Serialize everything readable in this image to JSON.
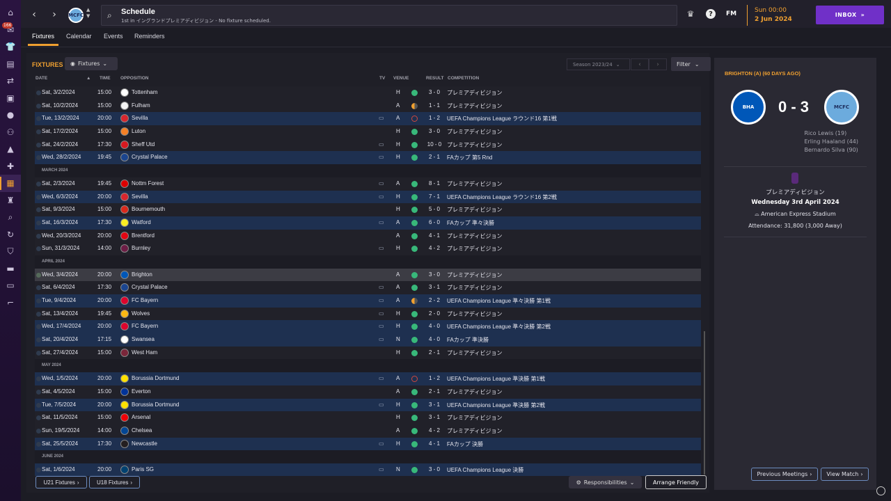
{
  "sidebar": {
    "badge": "166",
    "icons": [
      "home-icon",
      "inbox-icon",
      "kit-icon",
      "clipboard-icon",
      "transfer-icon",
      "scouting-icon",
      "globe-icon",
      "staff-icon",
      "training-icon",
      "medical-icon",
      "schedule-icon",
      "trophy-icon",
      "search-icon",
      "refresh-icon",
      "shield-icon",
      "briefcase-icon",
      "ticket-icon",
      "boots-icon"
    ]
  },
  "header": {
    "title": "Schedule",
    "subtitle": "1st in イングランドプレミアディビジョン - No fixture scheduled.",
    "fm_logo": "FM",
    "date_day": "Sun 00:00",
    "date_date": "2 Jun 2024",
    "inbox": "INBOX",
    "club_abbr": "MCFC"
  },
  "tabs": [
    "Fixtures",
    "Calendar",
    "Events",
    "Reminders"
  ],
  "fixtures": {
    "title": "FIXTURES",
    "view_dropdown": "Fixtures",
    "season": "Season 2023/24",
    "filter": "Filter",
    "columns": {
      "date": "DATE",
      "time": "TIME",
      "opposition": "OPPOSITION",
      "tv": "TV",
      "venue": "VENUE",
      "result": "RESULT",
      "competition": "COMPETITION"
    },
    "rows": [
      {
        "type": "match",
        "date": "Sat, 3/2/2024",
        "time": "15:00",
        "opp": "Tottenham",
        "crest": "#ffffff",
        "tv": "",
        "venue": "H",
        "result": "win",
        "score": "3 - 0",
        "comp": "プレミアディビジョン",
        "style": "plain"
      },
      {
        "type": "match",
        "date": "Sat, 10/2/2024",
        "time": "15:00",
        "opp": "Fulham",
        "crest": "#f4f4f4",
        "tv": "",
        "venue": "A",
        "result": "draw",
        "score": "1 - 1",
        "comp": "プレミアディビジョン",
        "style": "plain"
      },
      {
        "type": "match",
        "date": "Tue, 13/2/2024",
        "time": "20:00",
        "opp": "Sevilla",
        "crest": "#d8262e",
        "tv": "tv",
        "venue": "A",
        "result": "loss",
        "score": "1 - 2",
        "comp": "UEFA Champions League ラウンド16 第1戦",
        "style": "stripe"
      },
      {
        "type": "match",
        "date": "Sat, 17/2/2024",
        "time": "15:00",
        "opp": "Luton",
        "crest": "#f58025",
        "tv": "",
        "venue": "H",
        "result": "win",
        "score": "3 - 0",
        "comp": "プレミアディビジョン",
        "style": "plain"
      },
      {
        "type": "match",
        "date": "Sat, 24/2/2024",
        "time": "17:30",
        "opp": "Sheff Utd",
        "crest": "#d71920",
        "tv": "tv",
        "venue": "H",
        "result": "win",
        "score": "10 - 0",
        "comp": "プレミアディビジョン",
        "style": "plain"
      },
      {
        "type": "match",
        "date": "Wed, 28/2/2024",
        "time": "19:45",
        "opp": "Crystal Palace",
        "crest": "#1b458f",
        "tv": "tv",
        "venue": "H",
        "result": "win",
        "score": "2 - 1",
        "comp": "FAカップ 第5 Rnd",
        "style": "stripe"
      },
      {
        "type": "month",
        "label": "MARCH 2024"
      },
      {
        "type": "match",
        "date": "Sat, 2/3/2024",
        "time": "19:45",
        "opp": "Nottm Forest",
        "crest": "#dd0000",
        "tv": "tv",
        "venue": "A",
        "result": "win",
        "score": "8 - 1",
        "comp": "プレミアディビジョン",
        "style": "plain"
      },
      {
        "type": "match",
        "date": "Wed, 6/3/2024",
        "time": "20:00",
        "opp": "Sevilla",
        "crest": "#d8262e",
        "tv": "tv",
        "venue": "H",
        "result": "win",
        "score": "7 - 1",
        "comp": "UEFA Champions League ラウンド16 第2戦",
        "style": "stripe"
      },
      {
        "type": "match",
        "date": "Sat, 9/3/2024",
        "time": "15:00",
        "opp": "Bournemouth",
        "crest": "#da291c",
        "tv": "",
        "venue": "H",
        "result": "win",
        "score": "5 - 0",
        "comp": "プレミアディビジョン",
        "style": "plain"
      },
      {
        "type": "match",
        "date": "Sat, 16/3/2024",
        "time": "17:30",
        "opp": "Watford",
        "crest": "#fbee23",
        "tv": "tv",
        "venue": "A",
        "result": "win",
        "score": "6 - 0",
        "comp": "FAカップ 準々決勝",
        "style": "stripe"
      },
      {
        "type": "match",
        "date": "Wed, 20/3/2024",
        "time": "20:00",
        "opp": "Brentford",
        "crest": "#e30613",
        "tv": "",
        "venue": "A",
        "result": "win",
        "score": "4 - 1",
        "comp": "プレミアディビジョン",
        "style": "plain"
      },
      {
        "type": "match",
        "date": "Sun, 31/3/2024",
        "time": "14:00",
        "opp": "Burnley",
        "crest": "#6c1d45",
        "tv": "tv",
        "venue": "H",
        "result": "win",
        "score": "4 - 2",
        "comp": "プレミアディビジョン",
        "style": "plain"
      },
      {
        "type": "month",
        "label": "APRIL 2024"
      },
      {
        "type": "match",
        "date": "Wed, 3/4/2024",
        "time": "20:00",
        "opp": "Brighton",
        "crest": "#0057b8",
        "tv": "",
        "venue": "A",
        "result": "win",
        "score": "3 - 0",
        "comp": "プレミアディビジョン",
        "style": "highlight"
      },
      {
        "type": "match",
        "date": "Sat, 6/4/2024",
        "time": "17:30",
        "opp": "Crystal Palace",
        "crest": "#1b458f",
        "tv": "tv",
        "venue": "A",
        "result": "win",
        "score": "3 - 1",
        "comp": "プレミアディビジョン",
        "style": "plain"
      },
      {
        "type": "match",
        "date": "Tue, 9/4/2024",
        "time": "20:00",
        "opp": "FC Bayern",
        "crest": "#dc052d",
        "tv": "tv",
        "venue": "A",
        "result": "draw",
        "score": "2 - 2",
        "comp": "UEFA Champions League 準々決勝 第1戦",
        "style": "stripe"
      },
      {
        "type": "match",
        "date": "Sat, 13/4/2024",
        "time": "19:45",
        "opp": "Wolves",
        "crest": "#fdb913",
        "tv": "tv",
        "venue": "H",
        "result": "win",
        "score": "2 - 0",
        "comp": "プレミアディビジョン",
        "style": "plain"
      },
      {
        "type": "match",
        "date": "Wed, 17/4/2024",
        "time": "20:00",
        "opp": "FC Bayern",
        "crest": "#dc052d",
        "tv": "tv",
        "venue": "H",
        "result": "win",
        "score": "4 - 0",
        "comp": "UEFA Champions League 準々決勝 第2戦",
        "style": "stripe"
      },
      {
        "type": "match",
        "date": "Sat, 20/4/2024",
        "time": "17:15",
        "opp": "Swansea",
        "crest": "#ffffff",
        "tv": "tv",
        "venue": "N",
        "result": "win",
        "score": "4 - 0",
        "comp": "FAカップ 準決勝",
        "style": "stripe"
      },
      {
        "type": "match",
        "date": "Sat, 27/4/2024",
        "time": "15:00",
        "opp": "West Ham",
        "crest": "#7a263a",
        "tv": "",
        "venue": "H",
        "result": "win",
        "score": "2 - 1",
        "comp": "プレミアディビジョン",
        "style": "plain"
      },
      {
        "type": "month",
        "label": "MAY 2024"
      },
      {
        "type": "match",
        "date": "Wed, 1/5/2024",
        "time": "20:00",
        "opp": "Borussia Dortmund",
        "crest": "#fde100",
        "tv": "tv",
        "venue": "A",
        "result": "loss",
        "score": "1 - 2",
        "comp": "UEFA Champions League 準決勝 第1戦",
        "style": "stripe"
      },
      {
        "type": "match",
        "date": "Sat, 4/5/2024",
        "time": "15:00",
        "opp": "Everton",
        "crest": "#003399",
        "tv": "",
        "venue": "A",
        "result": "win",
        "score": "2 - 1",
        "comp": "プレミアディビジョン",
        "style": "plain"
      },
      {
        "type": "match",
        "date": "Tue, 7/5/2024",
        "time": "20:00",
        "opp": "Borussia Dortmund",
        "crest": "#fde100",
        "tv": "tv",
        "venue": "H",
        "result": "win",
        "score": "3 - 1",
        "comp": "UEFA Champions League 準決勝 第2戦",
        "style": "stripe"
      },
      {
        "type": "match",
        "date": "Sat, 11/5/2024",
        "time": "15:00",
        "opp": "Arsenal",
        "crest": "#ef0107",
        "tv": "",
        "venue": "H",
        "result": "win",
        "score": "3 - 1",
        "comp": "プレミアディビジョン",
        "style": "plain"
      },
      {
        "type": "match",
        "date": "Sun, 19/5/2024",
        "time": "14:00",
        "opp": "Chelsea",
        "crest": "#034694",
        "tv": "",
        "venue": "A",
        "result": "win",
        "score": "4 - 2",
        "comp": "プレミアディビジョン",
        "style": "plain"
      },
      {
        "type": "match",
        "date": "Sat, 25/5/2024",
        "time": "17:30",
        "opp": "Newcastle",
        "crest": "#241f20",
        "tv": "tv",
        "venue": "H",
        "result": "win",
        "score": "4 - 1",
        "comp": "FAカップ 決勝",
        "style": "stripe"
      },
      {
        "type": "month",
        "label": "JUNE 2024"
      },
      {
        "type": "match",
        "date": "Sat, 1/6/2024",
        "time": "20:00",
        "opp": "Paris SG",
        "crest": "#004170",
        "tv": "tv",
        "venue": "N",
        "result": "win",
        "score": "3 - 0",
        "comp": "UEFA Champions League 決勝",
        "style": "stripe"
      }
    ]
  },
  "bottom": {
    "u21": "U21 Fixtures",
    "u18": "U18 Fixtures",
    "responsibilities": "Responsibilities",
    "arrange": "Arrange Friendly"
  },
  "detail": {
    "title": "BRIGHTON (A) (60 DAYS AGO)",
    "score": "0 - 3",
    "home_abbr": "BHA",
    "away_abbr": "MCFC",
    "scorers": [
      "Rico Lewis (19)",
      "Erling Haaland (44)",
      "Bernardo Silva (90)"
    ],
    "competition": "プレミアディビジョン",
    "match_date": "Wednesday 3rd April 2024",
    "stadium": "American Express Stadium",
    "attendance": "Attendance: 31,800 (3,000 Away)",
    "prev_meetings": "Previous Meetings",
    "view_match": "View Match"
  }
}
